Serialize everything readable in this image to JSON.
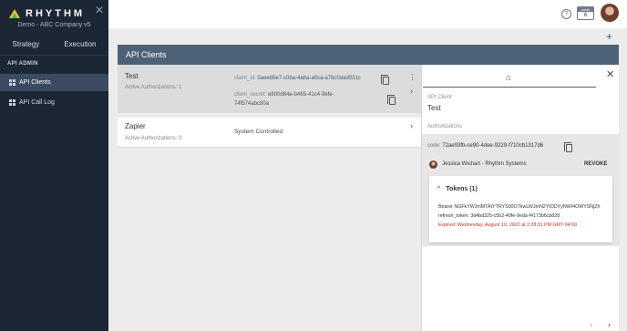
{
  "sidebar": {
    "logo_text": "RHYTHM",
    "company": "Demo - ABC Company v5",
    "modes": [
      "Strategy",
      "Execution"
    ],
    "section_label": "API ADMIN",
    "items": [
      {
        "label": "API Clients",
        "active": true
      },
      {
        "label": "API Call Log",
        "active": false
      }
    ]
  },
  "topbar": {
    "help_icon": "?",
    "week_label": "week",
    "week_number": "6"
  },
  "add_icon": "+",
  "panel": {
    "title": "API Clients"
  },
  "clients": [
    {
      "name": "Test",
      "authorizations_label": "Active Authorizations: 1",
      "client_id_label": "client_id:",
      "client_id": "0aeeb5e7-c0ba-4aba-a0ca-a76c0dad031c",
      "client_secret_label": "client_secret:",
      "client_secret_line1": "e800d64e-b465-41c4-9efe-",
      "client_secret_line2": "74f574abc80a"
    },
    {
      "name": "Zapier",
      "authorizations_label": "Active Authorizations: 0",
      "status": "System Controlled"
    }
  ],
  "detail": {
    "api_client_label": "API Client",
    "api_client_value": "Test",
    "authorizations_label": "Authorizations",
    "code_label": "code:",
    "code_value": "72ae93fb-ce90-4dee-9229-f710cb1317d6",
    "user_name": "Jessica Wishart - Rhythm Systems",
    "revoke_label": "REVOKE",
    "tokens_title": "Tokens (1)",
    "bearer": "Bearer NGFkYWJmMTAtYTRYS00OTkwLWJmN2YtODYyNWI4OWYSNjZh",
    "refresh": "refresh_token: 3d4bd325-c5b2-40fe-9eda-f4173b6cb828",
    "expired": "Expired: Wednesday, August 10, 2022 at 2:28:31 PM GMT-04:00"
  },
  "colors": {
    "sidebar_bg": "#1c2736",
    "panel_header": "#4d6275",
    "expired_red": "#d62b2b"
  }
}
